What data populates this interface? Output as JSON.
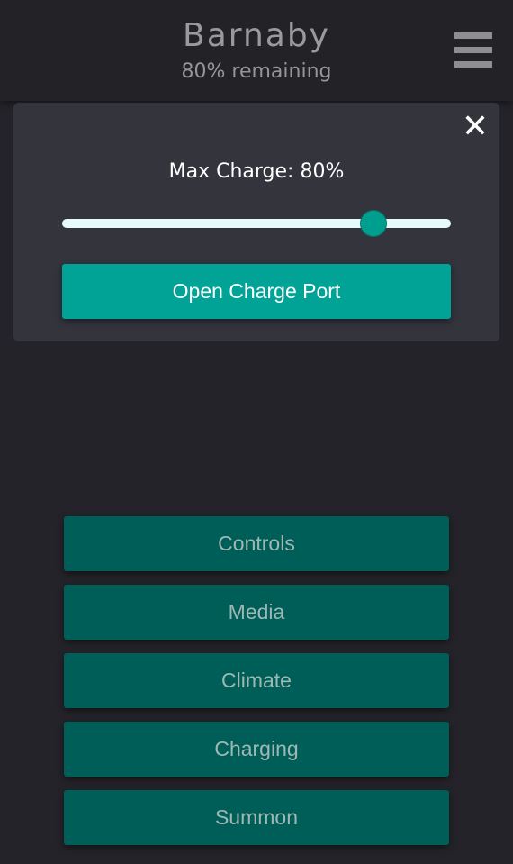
{
  "header": {
    "vehicle_name": "Barnaby",
    "status": "80% remaining",
    "menu_icon": "hamburger-menu-icon"
  },
  "charge_panel": {
    "close_icon": "close-icon",
    "max_charge_label": "Max Charge: 80%",
    "max_charge_percent": 80,
    "open_port_label": "Open Charge Port"
  },
  "nav": [
    {
      "label": "Controls"
    },
    {
      "label": "Media"
    },
    {
      "label": "Climate"
    },
    {
      "label": "Charging"
    },
    {
      "label": "Summon"
    }
  ],
  "colors": {
    "background": "#232329",
    "panel": "#34343d",
    "accent": "#00a396",
    "nav_button": "#005e58"
  }
}
